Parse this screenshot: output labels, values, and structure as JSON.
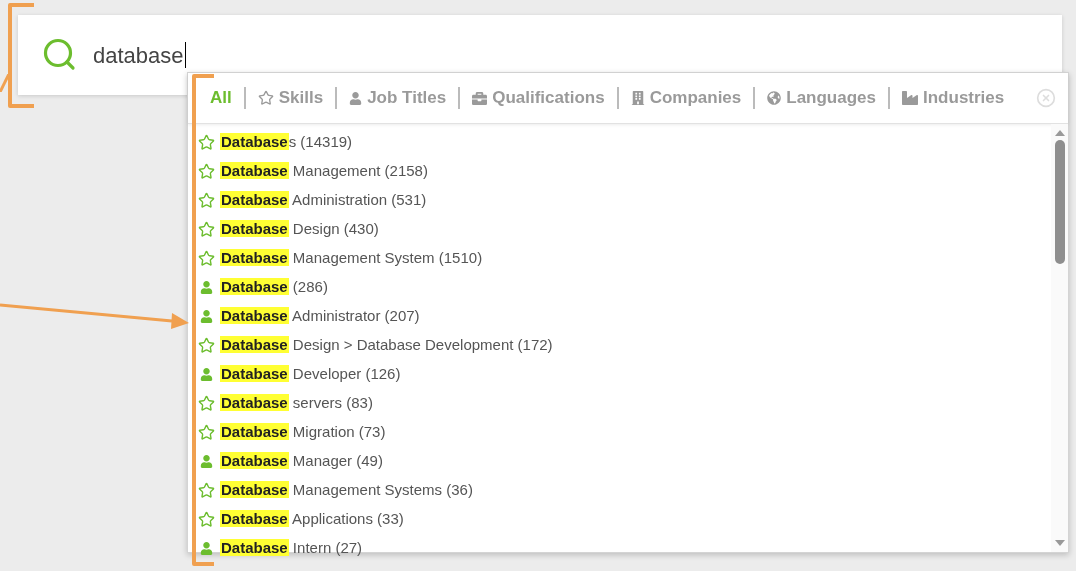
{
  "search": {
    "value": "database"
  },
  "tabs": [
    {
      "label": "All",
      "kind": "all",
      "selected": true
    },
    {
      "label": "Skills",
      "kind": "skill",
      "selected": false
    },
    {
      "label": "Job Titles",
      "kind": "job_title",
      "selected": false
    },
    {
      "label": "Qualifications",
      "kind": "qualification",
      "selected": false
    },
    {
      "label": "Companies",
      "kind": "company",
      "selected": false
    },
    {
      "label": "Languages",
      "kind": "language",
      "selected": false
    },
    {
      "label": "Industries",
      "kind": "industry",
      "selected": false
    }
  ],
  "results": [
    {
      "kind": "skill",
      "match": "Database",
      "rest": "s (14319)"
    },
    {
      "kind": "skill",
      "match": "Database",
      "rest": " Management (2158)"
    },
    {
      "kind": "skill",
      "match": "Database",
      "rest": " Administration (531)"
    },
    {
      "kind": "skill",
      "match": "Database",
      "rest": " Design (430)"
    },
    {
      "kind": "skill",
      "match": "Database",
      "rest": " Management System (1510)"
    },
    {
      "kind": "job_title",
      "match": "Database",
      "rest": " (286)"
    },
    {
      "kind": "job_title",
      "match": "Database",
      "rest": " Administrator (207)"
    },
    {
      "kind": "skill",
      "match": "Database",
      "rest": " Design > Database Development (172)"
    },
    {
      "kind": "job_title",
      "match": "Database",
      "rest": " Developer (126)"
    },
    {
      "kind": "skill",
      "match": "Database",
      "rest": " servers (83)"
    },
    {
      "kind": "skill",
      "match": "Database",
      "rest": " Migration (73)"
    },
    {
      "kind": "job_title",
      "match": "Database",
      "rest": " Manager (49)"
    },
    {
      "kind": "skill",
      "match": "Database",
      "rest": " Management Systems (36)"
    },
    {
      "kind": "skill",
      "match": "Database",
      "rest": " Applications (33)"
    },
    {
      "kind": "job_title",
      "match": "Database",
      "rest": " Intern (27)"
    }
  ]
}
